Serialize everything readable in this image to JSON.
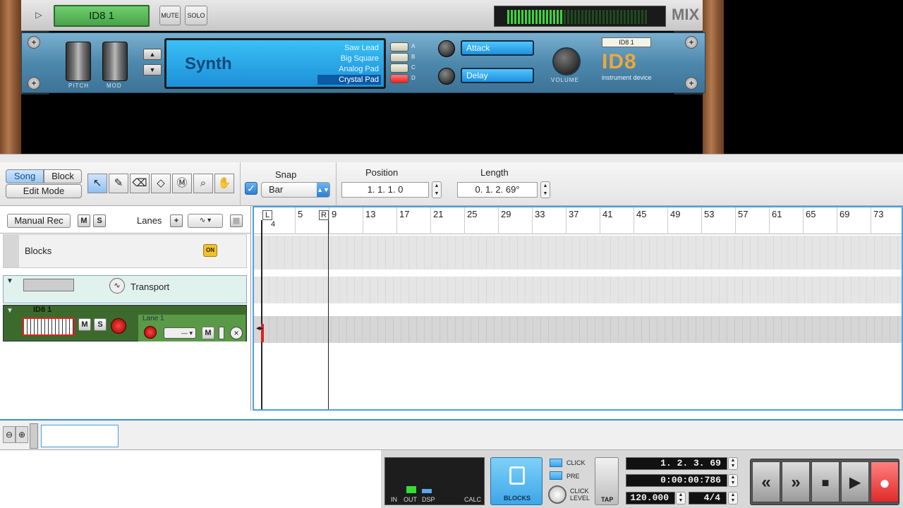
{
  "rack": {
    "mix_strip": {
      "device_name": "ID8 1",
      "mute": "MUTE",
      "solo": "SOLO",
      "mix_label": "MIX"
    },
    "device": {
      "pitch_label": "PITCH",
      "mod_label": "MOD",
      "display_title": "Synth",
      "patches": [
        "Saw Lead",
        "Big Square",
        "Analog Pad",
        "Crystal Pad"
      ],
      "selected_patch": "Crystal Pad",
      "patch_letters": [
        "A",
        "B",
        "C",
        "D"
      ],
      "param1": "Attack",
      "param2": "Delay",
      "volume_label": "VOLUME",
      "name_tag": "ID8 1",
      "logo": "ID8",
      "logo_sub": "instrument device"
    }
  },
  "toolbar": {
    "song": "Song",
    "block": "Block",
    "edit_mode": "Edit Mode",
    "snap_label": "Snap",
    "snap_value": "Bar",
    "position_label": "Position",
    "position_value": "1.  1.  1.    0",
    "length_label": "Length",
    "length_value": "0.  1.  2.  69°"
  },
  "tracks": {
    "manual_rec": "Manual Rec",
    "m": "M",
    "s": "S",
    "lanes": "Lanes",
    "plus": "+",
    "blocks": "Blocks",
    "on": "ON",
    "transport": "Transport",
    "synth_name": "ID8 1",
    "lane_name": "Lane 1"
  },
  "ruler": {
    "markers": [
      "5",
      "9",
      "13",
      "17",
      "21",
      "25",
      "29",
      "33",
      "37",
      "41",
      "45",
      "49",
      "53",
      "57",
      "61",
      "65",
      "69",
      "73"
    ],
    "sub_label": "4"
  },
  "bottom": {
    "in": "IN",
    "out": "OUT",
    "dsp": "DSP",
    "calc": "CALC",
    "blocks": "BLOCKS",
    "click": "CLICK",
    "pre": "PRE",
    "click_level_1": "CLICK",
    "click_level_2": "LEVEL",
    "tap": "TAP",
    "bars": "1.  2.  3.  69",
    "time": "0:00:00:786",
    "tempo": "120.000",
    "signature": "4/4"
  },
  "colors": {
    "accent": "#3a8fd6",
    "record": "#e63b3b",
    "device": "#4d89ad",
    "track_green": "#3c6a2c"
  }
}
